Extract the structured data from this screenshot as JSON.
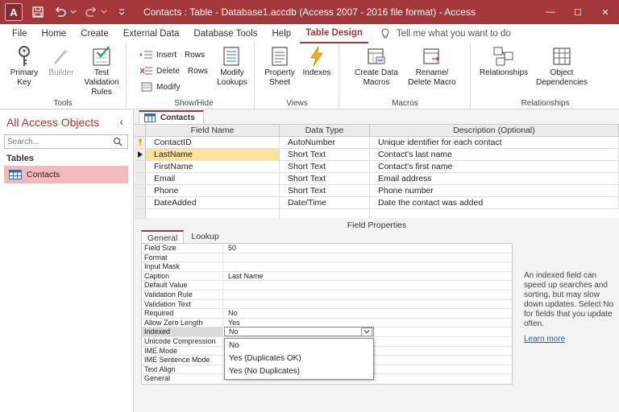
{
  "titlebar": {
    "app_letter": "A",
    "title": "Contacts : Table - Database1.accdb (Access 2007 - 2016 file format) - Access",
    "minimize": "—",
    "maximize": "☐",
    "close": "✕"
  },
  "menu": {
    "items": [
      "File",
      "Home",
      "Create",
      "External Data",
      "Database Tools",
      "Help",
      "Table Design"
    ],
    "active": "Table Design",
    "tell_me": "Tell me what you want to do"
  },
  "ribbon": {
    "tools": {
      "label": "Tools",
      "primary_key": "Primary Key",
      "builder": "Builder",
      "test_validation": "Test Validation Rules"
    },
    "show_hide": {
      "label": "Show/Hide",
      "insert_rows": "Insert",
      "delete_rows": "Delete",
      "rows_1": "Rows",
      "rows_2": "Rows",
      "modify": "Modify",
      "modify_lookups": "Modify Lookups"
    },
    "views": {
      "label": "Views",
      "property_sheet": "Property Sheet",
      "indexes": "Indexes"
    },
    "macros": {
      "label": "Macros",
      "create_data_macros": "Create Data Macros",
      "rename_delete_macro": "Rename/ Delete Macro"
    },
    "relationships": {
      "label": "Relationships",
      "relationships": "Relationships",
      "object_dependencies": "Object Dependencies"
    }
  },
  "nav": {
    "title": "All Access Objects",
    "collapse": "‹",
    "search_placeholder": "Search...",
    "section": "Tables",
    "items": [
      "Contacts"
    ]
  },
  "doc_tab": "Contacts",
  "grid": {
    "headers": [
      "Field Name",
      "Data Type",
      "Description (Optional)"
    ],
    "rows": [
      {
        "name": "ContactID",
        "type": "AutoNumber",
        "desc": "Unique identifier for each contact"
      },
      {
        "name": "LastName",
        "type": "Short Text",
        "desc": "Contact's last name"
      },
      {
        "name": "FirstName",
        "type": "Short Text",
        "desc": "Contact's first name"
      },
      {
        "name": "Email",
        "type": "Short Text",
        "desc": "Email address"
      },
      {
        "name": "Phone",
        "type": "Short Text",
        "desc": "Phone number"
      },
      {
        "name": "DateAdded",
        "type": "Date/Time",
        "desc": "Date the contact was added"
      }
    ]
  },
  "field_properties": {
    "title": "Field Properties",
    "tabs": [
      "General",
      "Lookup"
    ],
    "rows": [
      {
        "label": "Field Size",
        "value": "50"
      },
      {
        "label": "Format",
        "value": ""
      },
      {
        "label": "Input Mask",
        "value": ""
      },
      {
        "label": "Caption",
        "value": "Last Name"
      },
      {
        "label": "Default Value",
        "value": ""
      },
      {
        "label": "Validation Rule",
        "value": ""
      },
      {
        "label": "Validation Text",
        "value": ""
      },
      {
        "label": "Required",
        "value": "No"
      },
      {
        "label": "Allow Zero Length",
        "value": "Yes"
      },
      {
        "label": "Indexed",
        "value": "No"
      },
      {
        "label": "Unicode Compression",
        "value": ""
      },
      {
        "label": "IME Mode",
        "value": ""
      },
      {
        "label": "IME Sentence Mode",
        "value": ""
      },
      {
        "label": "Text Align",
        "value": ""
      },
      {
        "label": "General",
        "value": ""
      }
    ],
    "dropdown_options": [
      "No",
      "Yes (Duplicates OK)",
      "Yes (No Duplicates)"
    ],
    "help_text": "An indexed field can speed up searches and sorting, but may slow down updates. Select No for fields that you update often.",
    "learn_more": "Learn more"
  },
  "colors": {
    "accent": "#a4373a",
    "selected_row": "#fbe39a",
    "nav_selected": "#f4b9bd",
    "link": "#1e5fa8"
  }
}
